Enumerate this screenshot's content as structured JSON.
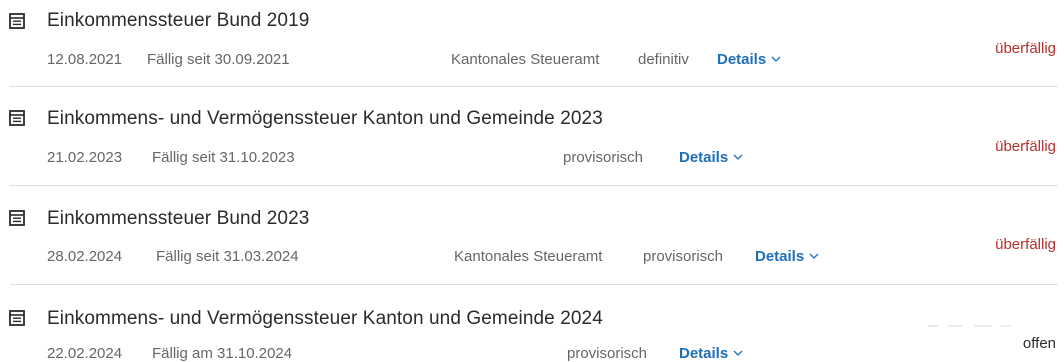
{
  "invoices": [
    {
      "icon": "document-icon",
      "title": "Einkommenssteuer Bund 2019",
      "date": "12.08.2021",
      "due": "Fällig seit 30.09.2021",
      "authority": "Kantonales Steueramt",
      "kind": "definitiv",
      "details": "Details",
      "status": "überfällig"
    },
    {
      "icon": "document-icon",
      "title": "Einkommens- und Vermögenssteuer Kanton und Gemeinde 2023",
      "date": "21.02.2023",
      "due": "Fällig seit 31.10.2023",
      "authority": "",
      "kind": "provisorisch",
      "details": "Details",
      "status": "überfällig"
    },
    {
      "icon": "document-icon",
      "title": "Einkommenssteuer Bund 2023",
      "date": "28.02.2024",
      "due": "Fällig seit 31.03.2024",
      "authority": "Kantonales Steueramt",
      "kind": "provisorisch",
      "details": "Details",
      "status": "überfällig"
    },
    {
      "icon": "document-icon",
      "title": "Einkommens- und Vermögenssteuer Kanton und Gemeinde 2024",
      "date": "22.02.2024",
      "due": "Fällig am 31.10.2024",
      "authority": "",
      "kind": "provisorisch",
      "details": "Details",
      "status": "offen"
    }
  ],
  "colors": {
    "overdue": "#b3312f",
    "link": "#1f6fb5",
    "meta": "#666666",
    "divider": "#dddddd"
  }
}
